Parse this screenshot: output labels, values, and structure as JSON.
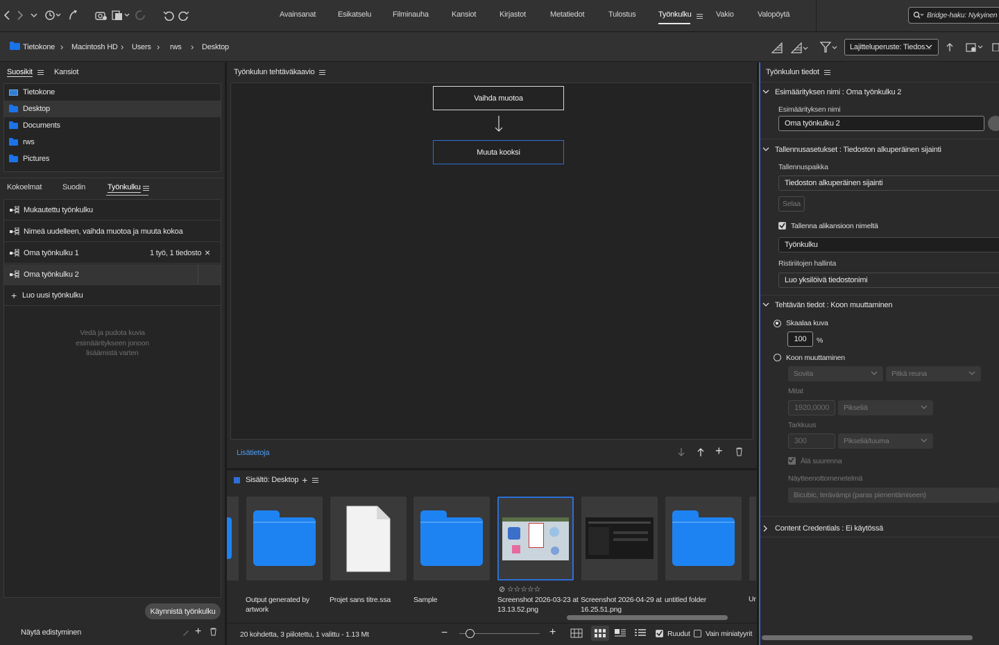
{
  "workspace_tabs": [
    "Avainsanat",
    "Esikatselu",
    "Filminauha",
    "Kansiot",
    "Kirjastot",
    "Metatiedot",
    "Tulostus",
    "Työnkulku",
    "Vakio",
    "Valopöytä"
  ],
  "active_workspace": "Työnkulku",
  "search": {
    "placeholder": "Bridge-haku: Nykyinen"
  },
  "breadcrumb": [
    "Tietokone",
    "Macintosh HD",
    "Users",
    "rws",
    "Desktop"
  ],
  "sort": {
    "label": "Lajitteluperuste: Tiedos..."
  },
  "left": {
    "tabs_top": [
      "Suosikit",
      "Kansiot"
    ],
    "favorites": [
      "Tietokone",
      "Desktop",
      "Documents",
      "rws",
      "Pictures"
    ],
    "selected_favorite": "Desktop",
    "tabs_bottom": [
      "Kokoelmat",
      "Suodin",
      "Työnkulku"
    ],
    "workflows": [
      {
        "name": "Mukautettu työnkulku",
        "info": ""
      },
      {
        "name": "Nimeä uudelleen, vaihda muotoa ja muuta kokoa",
        "info": ""
      },
      {
        "name": "Oma työnkulku 1",
        "info": "1 työ, 1 tiedosto"
      },
      {
        "name": "Oma työnkulku 2",
        "info": ""
      }
    ],
    "new_workflow": "Luo uusi työnkulku",
    "drop_hint": "Vedä ja pudota kuvia esimääritykseen jonoon lisäämistä varten",
    "start_button": "Käynnistä työnkulku",
    "show_progress": "Näytä edistyminen"
  },
  "center": {
    "diagram_title": "Työnkulun tehtäväkaavio",
    "nodes": [
      "Vaihda muotoa",
      "Muuta kooksi"
    ],
    "more_info": "Lisätietoja",
    "content_title": "Sisältö: Desktop",
    "thumbnails": [
      {
        "label": "Output generated by artwork",
        "kind": "folder"
      },
      {
        "label": "Projet sans titre.ssa",
        "kind": "file"
      },
      {
        "label": "Sample",
        "kind": "folder"
      },
      {
        "label": "Screenshot 2026-03-23 at 13.13.52.png",
        "kind": "image"
      },
      {
        "label": "Screenshot 2026-04-29 at 16.25.51.png",
        "kind": "image-dark"
      },
      {
        "label": "untitled folder",
        "kind": "folder"
      },
      {
        "label": "Ur",
        "kind": "partial"
      }
    ],
    "status": "20 kohdetta, 3 piilotettu, 1 valittu - 1.13 Mt",
    "grid_label": "Ruudut",
    "thumbs_only_label": "Vain miniatyyrit"
  },
  "right": {
    "title": "Työnkulun tiedot",
    "sec1": {
      "title": "Esimäärityksen nimi",
      "value": "Oma työnkulku 2",
      "field_label": "Esimäärityksen nimi",
      "field_value": "Oma työnkulku 2"
    },
    "sec2": {
      "title": "Tallennusasetukset",
      "value": "Tiedoston alkuperäinen sijainti",
      "location_label": "Tallennuspaikka",
      "location_value": "Tiedoston alkuperäinen sijainti",
      "browse": "Selaa",
      "subfolder_label": "Tallenna alikansioon nimeltä",
      "subfolder_value": "Työnkulku",
      "conflict_label": "Ristiriitojen hallinta",
      "conflict_value": "Luo yksilöivä tiedostonimi"
    },
    "sec3": {
      "title": "Tehtävän tiedot",
      "value": "Koon muuttaminen",
      "scale_label": "Skaalaa kuva",
      "scale_value": "100",
      "scale_unit": "%",
      "resize_label": "Koon muuttaminen",
      "fit": "Sovita",
      "long_edge": "Pitkä reuna",
      "dims_label": "Mitat",
      "dims_value": "1920,0000",
      "dims_unit": "Pikseliä",
      "res_label": "Tarkkuus",
      "res_value": "300",
      "res_unit": "Pikseliä/tuuma",
      "no_enlarge": "Älä suurenna",
      "sampling_label": "Näytteenottomenetelmä",
      "sampling_value": "Bicubic, terävämpi (paras pienentämiseen)"
    },
    "sec4": {
      "title": "Content Credentials",
      "value": "Ei käytössä"
    }
  }
}
